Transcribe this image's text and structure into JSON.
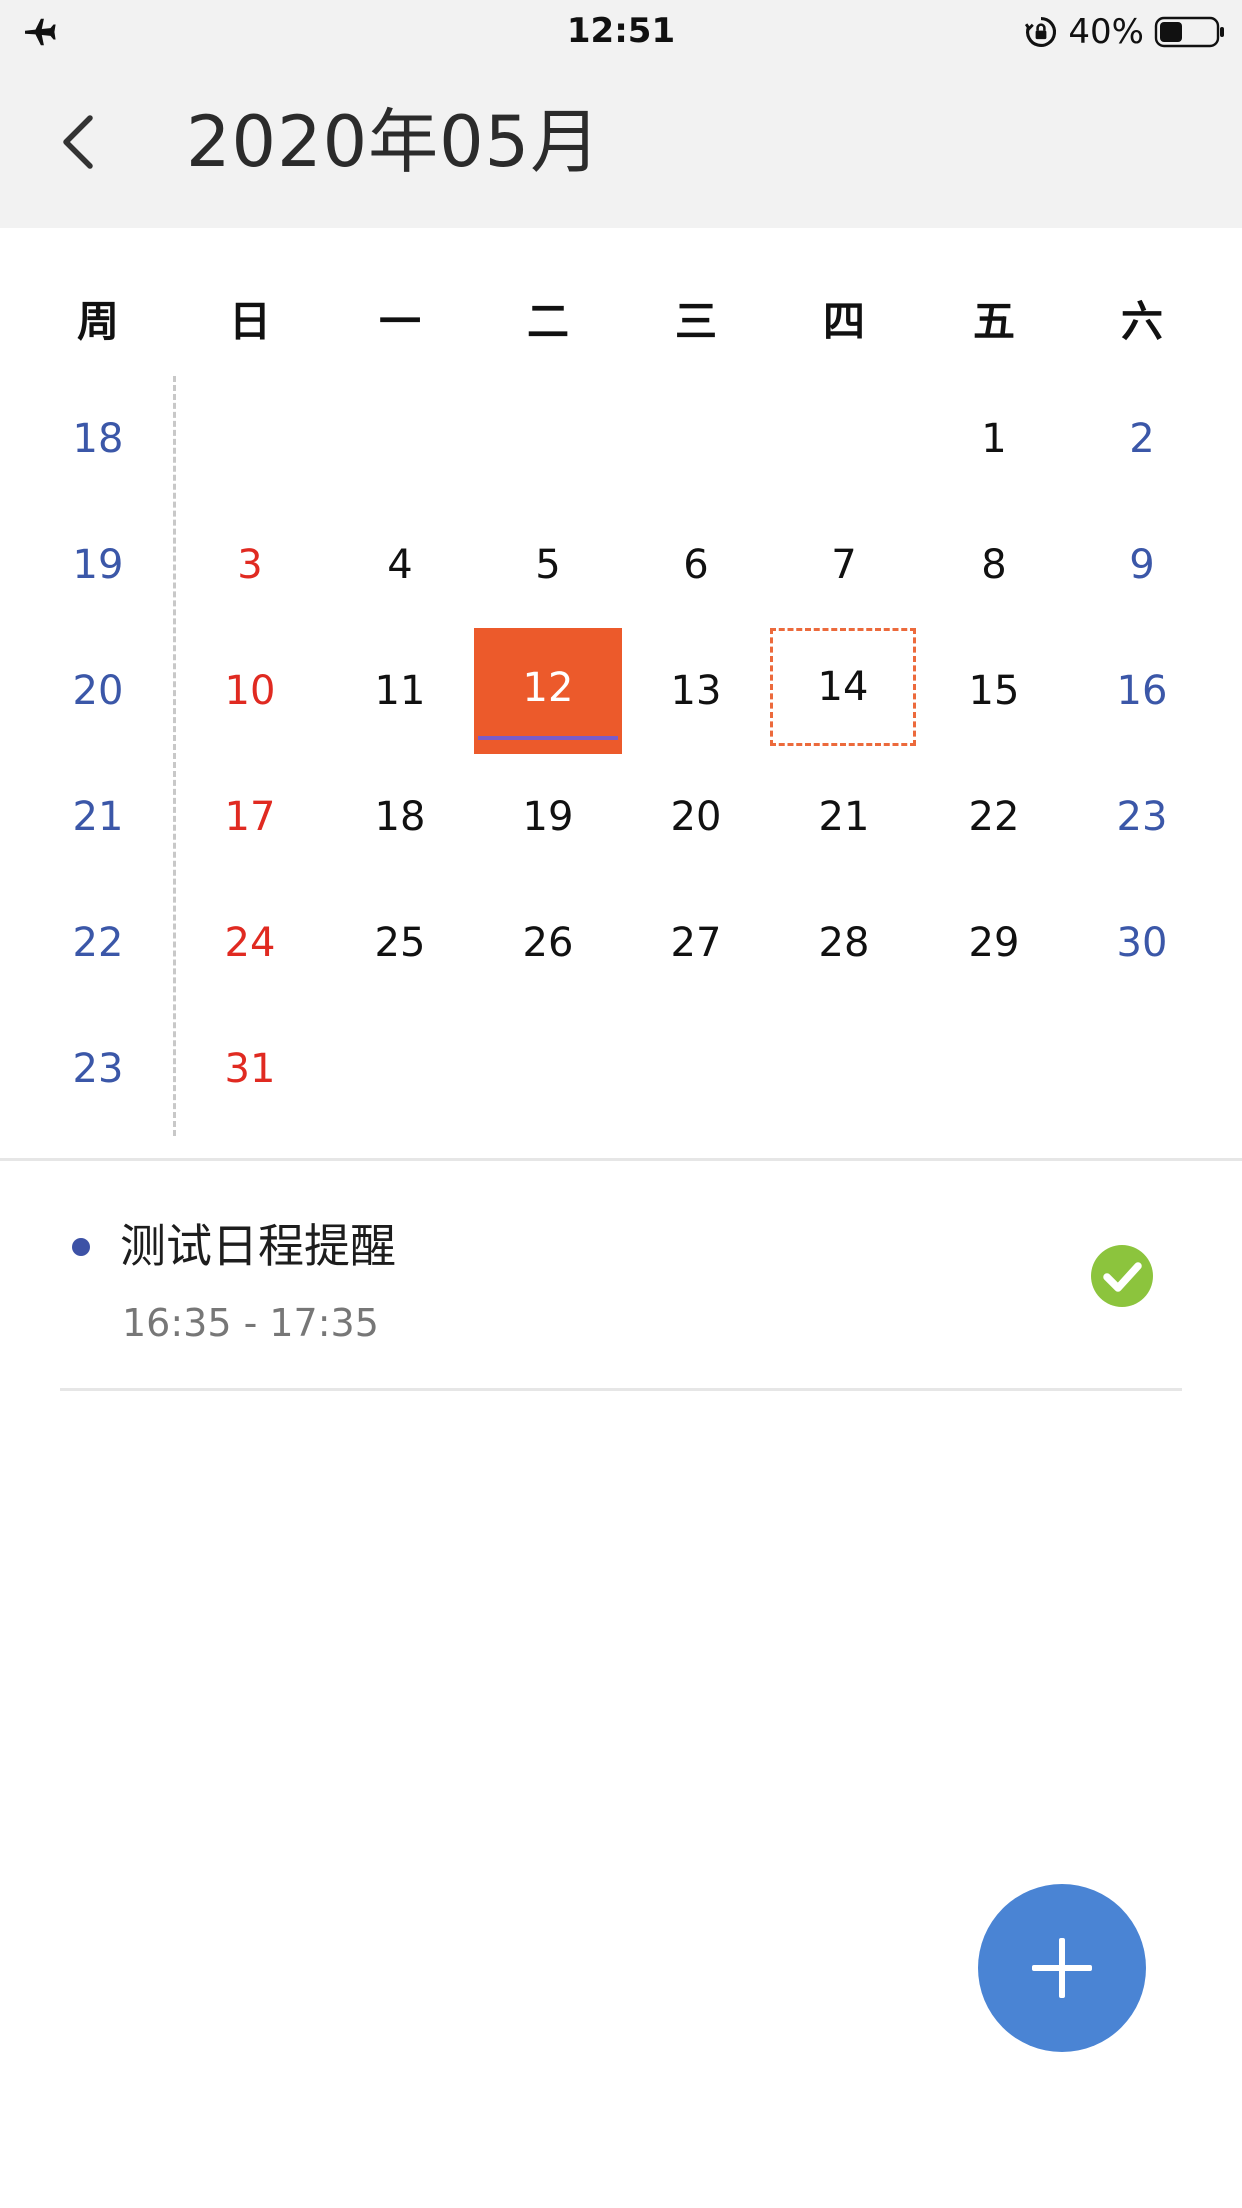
{
  "status_bar": {
    "time": "12:51",
    "battery_percent": "40%",
    "battery_level": 0.4,
    "icons": [
      "airplane-icon",
      "rotation-lock-icon",
      "battery-icon"
    ]
  },
  "header": {
    "title": "2020年05月",
    "back_icon": "chevron-left-icon"
  },
  "calendar": {
    "headers": [
      "周",
      "日",
      "一",
      "二",
      "三",
      "四",
      "五",
      "六"
    ],
    "weeks": [
      {
        "week": "18",
        "days": [
          "",
          "",
          "",
          "",
          "",
          "1",
          "2"
        ]
      },
      {
        "week": "19",
        "days": [
          "3",
          "4",
          "5",
          "6",
          "7",
          "8",
          "9"
        ]
      },
      {
        "week": "20",
        "days": [
          "10",
          "11",
          "12",
          "13",
          "14",
          "15",
          "16"
        ]
      },
      {
        "week": "21",
        "days": [
          "17",
          "18",
          "19",
          "20",
          "21",
          "22",
          "23"
        ]
      },
      {
        "week": "22",
        "days": [
          "24",
          "25",
          "26",
          "27",
          "28",
          "29",
          "30"
        ]
      },
      {
        "week": "23",
        "days": [
          "31",
          "",
          "",
          "",
          "",
          "",
          ""
        ]
      }
    ],
    "selected_day": "12",
    "today_day": "14",
    "colors": {
      "week_number": "#3b57a8",
      "sunday": "#e02a21",
      "saturday": "#3b57a8",
      "weekday": "#111111",
      "selected_bg": "#ec5a2b",
      "today_border": "#ec6a3c"
    }
  },
  "events": [
    {
      "title": "测试日程提醒",
      "time": "16:35 - 17:35",
      "dot_color": "#3d52a6",
      "status_icon": "check-circle-icon",
      "status_color": "#8cc43d"
    }
  ],
  "fab": {
    "icon": "plus-icon",
    "color": "#4a84d4"
  }
}
